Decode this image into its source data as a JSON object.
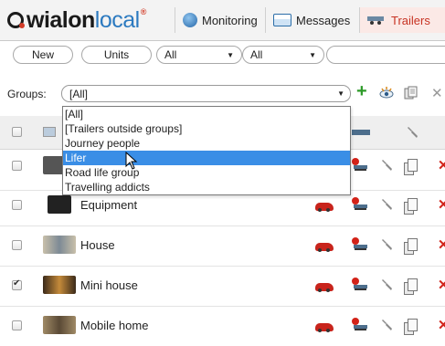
{
  "header": {
    "logo": {
      "part1": "wialon",
      "part2": "local",
      "mark": "®"
    },
    "tabs": [
      {
        "label": "Monitoring",
        "icon": "globe-icon"
      },
      {
        "label": "Messages",
        "icon": "messages-icon"
      },
      {
        "label": "Trailers",
        "icon": "trailer-icon",
        "active": true
      }
    ]
  },
  "filters": {
    "new_label": "New",
    "units_label": "Units",
    "select1_value": "All",
    "select2_value": "All",
    "search_value": ""
  },
  "groups": {
    "label": "Groups:",
    "selected_value": "[All]",
    "options": [
      "[All]",
      "[Trailers outside groups]",
      "Journey people",
      "Lifer",
      "Road life group",
      "Travelling addicts"
    ],
    "highlighted_index": 3
  },
  "table": {
    "rows": [
      {
        "name": "",
        "checked": false,
        "thumb_color": "#555555"
      },
      {
        "name": "Equipment",
        "checked": false,
        "thumb_color": "#222222"
      },
      {
        "name": "House",
        "checked": false,
        "thumb_color": "#b9a98a"
      },
      {
        "name": "Mini house",
        "checked": true,
        "thumb_color": "#6b4a2a"
      },
      {
        "name": "Mobile home",
        "checked": false,
        "thumb_color": "#8a7a5a"
      }
    ]
  },
  "colors": {
    "accent_red": "#c73222",
    "selection_blue": "#3a8ee6",
    "add_green": "#2d9a28"
  }
}
